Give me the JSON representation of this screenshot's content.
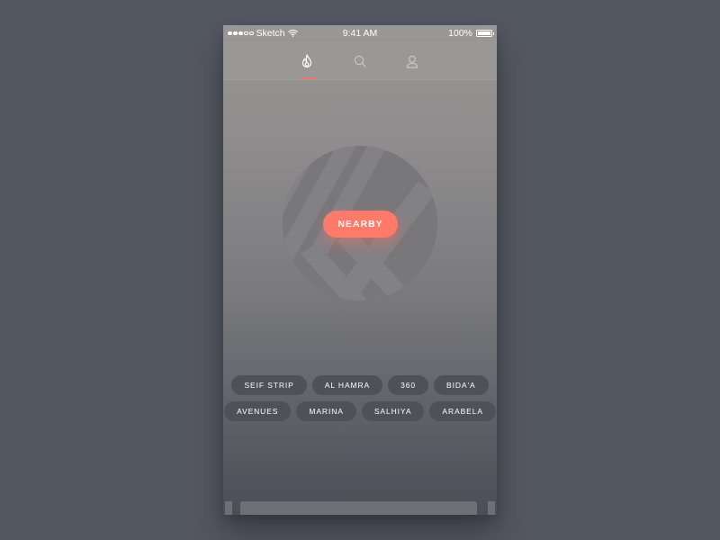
{
  "status_bar": {
    "carrier": "Sketch",
    "time": "9:41 AM",
    "battery": "100%"
  },
  "nav": {
    "tabs": [
      {
        "icon": "flame-icon",
        "active": true
      },
      {
        "icon": "search-icon",
        "active": false
      },
      {
        "icon": "user-icon",
        "active": false
      }
    ],
    "accent": "#ff6f5e"
  },
  "main": {
    "primary_button": "NEARBY"
  },
  "locations": {
    "row1": [
      "SEIF STRIP",
      "AL HAMRA",
      "360",
      "BIDA'A"
    ],
    "row2": [
      "AVENUES",
      "MARINA",
      "SALHIYA",
      "ARABELA"
    ]
  },
  "colors": {
    "background": "#545862",
    "button": "#ff7a68",
    "chip": "#505158"
  }
}
